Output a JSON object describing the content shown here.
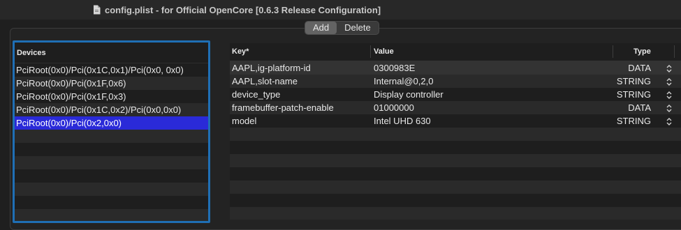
{
  "window": {
    "title": "config.plist - for Official OpenCore [0.6.3 Release Configuration]"
  },
  "segmented": {
    "add_label": "Add",
    "delete_label": "Delete"
  },
  "devices": {
    "header": "Devices",
    "items": [
      "PciRoot(0x0)/Pci(0x1C,0x1)/Pci(0x0, 0x0)",
      "PciRoot(0x0)/Pci(0x1F,0x6)",
      "PciRoot(0x0)/Pci(0x1F,0x3)",
      "PciRoot(0x0)/Pci(0x1C,0x2)/Pci(0x0,0x0)",
      "PciRoot(0x0)/Pci(0x2,0x0)"
    ],
    "selected_index": 4
  },
  "table": {
    "headers": {
      "key": "Key*",
      "value": "Value",
      "type": "Type"
    },
    "rows": [
      {
        "key": "AAPL,ig-platform-id",
        "value": "0300983E",
        "type": "DATA"
      },
      {
        "key": "AAPL,slot-name",
        "value": "Internal@0,2,0",
        "type": "STRING"
      },
      {
        "key": "device_type",
        "value": "Display controller",
        "type": "STRING"
      },
      {
        "key": "framebuffer-patch-enable",
        "value": "01000000",
        "type": "DATA"
      },
      {
        "key": "model",
        "value": "Intel UHD 630",
        "type": "STRING"
      }
    ]
  },
  "colors": {
    "selection": "#2a2ad8",
    "focus_ring": "#1f6fb5"
  }
}
